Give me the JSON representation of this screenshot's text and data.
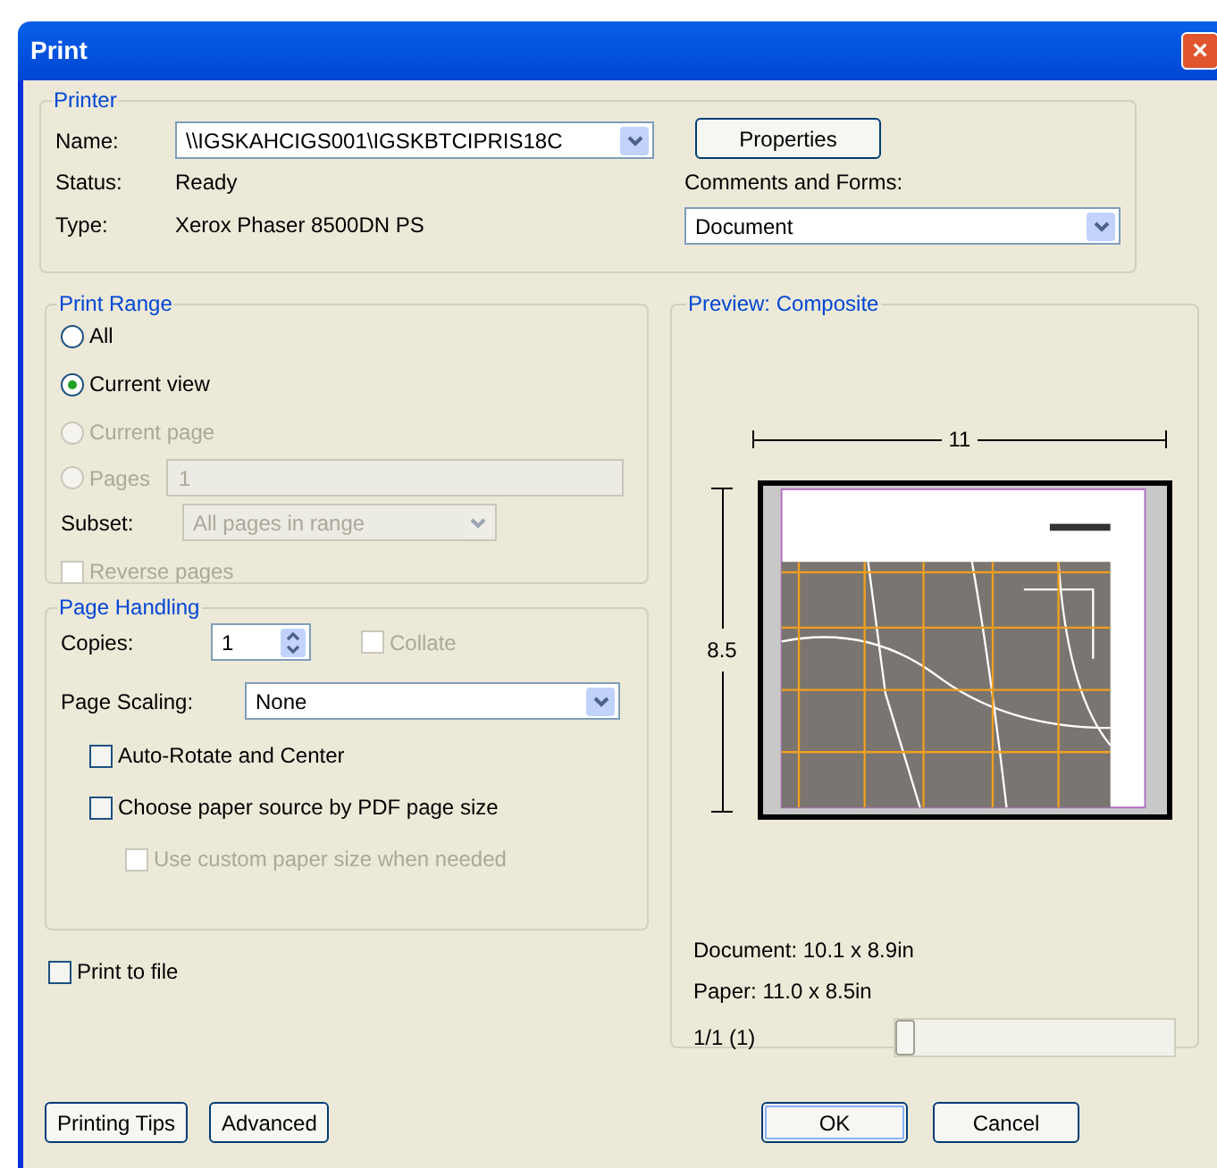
{
  "window": {
    "title": "Print",
    "close": "×"
  },
  "printer": {
    "title": "Printer",
    "name_label": "Name:",
    "name_value": "\\\\IGSKAHCIGS001\\IGSKBTCIPRIS18C",
    "status_label": "Status:",
    "status": "Ready",
    "type_label": "Type:",
    "type": "Xerox Phaser 8500DN PS",
    "properties_button": "Properties",
    "comments_label": "Comments and Forms:",
    "comments_value": "Document"
  },
  "print_range": {
    "title": "Print Range",
    "options": [
      {
        "label": "All",
        "selected": false,
        "disabled": false
      },
      {
        "label": "Current view",
        "selected": true,
        "disabled": false
      },
      {
        "label": "Current page",
        "selected": false,
        "disabled": true
      },
      {
        "label": "Pages",
        "selected": false,
        "disabled": true,
        "value": "1"
      }
    ],
    "subset_label": "Subset:",
    "subset_value": "All pages in range",
    "subset_disabled": true,
    "reverse": {
      "label": "Reverse pages",
      "checked": false,
      "disabled": true
    }
  },
  "page_handling": {
    "title": "Page Handling",
    "copies_label": "Copies:",
    "copies_value": "1",
    "collate": {
      "label": "Collate",
      "checked": false,
      "disabled": true
    },
    "scaling_label": "Page Scaling:",
    "scaling_value": "None",
    "options": [
      {
        "label": "Auto-Rotate and Center",
        "checked": false,
        "disabled": false
      },
      {
        "label": "Choose paper source by PDF page size",
        "checked": false,
        "disabled": false,
        "children": [
          {
            "label": "Use custom paper size when needed",
            "checked": false,
            "disabled": true
          }
        ]
      }
    ]
  },
  "print_to_file": {
    "label": "Print to file",
    "checked": false
  },
  "preview": {
    "title": "Preview: Composite",
    "width_label": "11",
    "height_label": "8.5",
    "document": "Document: 10.1 x 8.9in",
    "paper": "Paper: 11.0 x 8.5in",
    "page_counter": "1/1 (1)",
    "level": 0
  },
  "buttons_left": [
    {
      "label": "Printing Tips"
    },
    {
      "label": "Advanced"
    }
  ],
  "buttons_right": [
    {
      "label": "OK",
      "default": true
    },
    {
      "label": "Cancel",
      "default": false
    }
  ]
}
